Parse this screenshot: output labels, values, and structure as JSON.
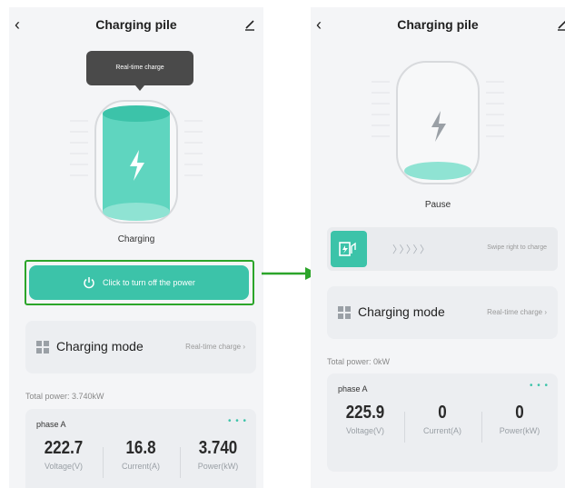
{
  "left": {
    "title": "Charging pile",
    "tooltip": "Real-time charge",
    "status": "Charging",
    "power_button_label": "Click to turn off the power",
    "mode_label": "Charging mode",
    "mode_value": "Real-time charge",
    "total_power": "Total power:  3.740kW",
    "phase": {
      "label": "phase A",
      "dots": "• • •",
      "voltage": "222.7",
      "voltage_label": "Voltage(V)",
      "current": "16.8",
      "current_label": "Current(A)",
      "power": "3.740",
      "power_label": "Power(kW)"
    }
  },
  "right": {
    "title": "Charging pile",
    "status": "Pause",
    "swipe_arrows": "〉〉〉〉〉",
    "swipe_text": "Swipe right to charge",
    "mode_label": "Charging mode",
    "mode_value": "Real-time charge",
    "total_power": "Total power:  0kW",
    "phase": {
      "label": "phase A",
      "dots": "• • •",
      "voltage": "225.9",
      "voltage_label": "Voltage(V)",
      "current": "0",
      "current_label": "Current(A)",
      "power": "0",
      "power_label": "Power(kW)"
    }
  },
  "icons": {
    "back": "‹",
    "chevron": "›"
  },
  "colors": {
    "accent": "#3cc3a9",
    "highlight": "#2ca52a",
    "background": "#f4f5f7"
  }
}
